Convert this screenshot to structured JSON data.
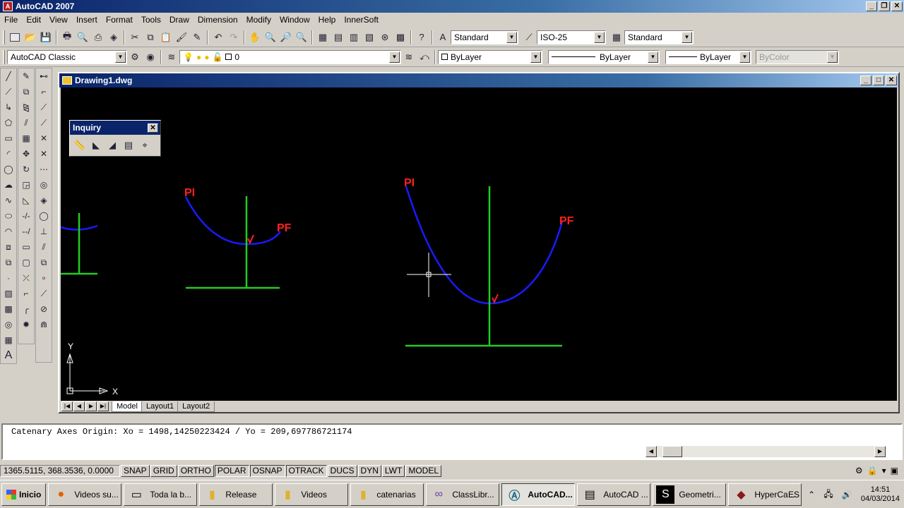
{
  "app": {
    "title": "AutoCAD 2007"
  },
  "menu": [
    "File",
    "Edit",
    "View",
    "Insert",
    "Format",
    "Tools",
    "Draw",
    "Dimension",
    "Modify",
    "Window",
    "Help",
    "InnerSoft"
  ],
  "toolbar": {
    "text_style": "Standard",
    "dim_style": "ISO-25",
    "table_style": "Standard",
    "workspace": "AutoCAD Classic",
    "layer": "0",
    "color": "ByLayer",
    "linetype": "ByLayer",
    "lineweight": "ByLayer",
    "plotstyle": "ByColor"
  },
  "document": {
    "title": "Drawing1.dwg"
  },
  "inquiry": {
    "title": "Inquiry"
  },
  "drawing": {
    "labels": {
      "pi": "PI",
      "pf": "PF"
    },
    "ucs": {
      "x": "X",
      "y": "Y"
    },
    "colors": {
      "curve": "#1a1aff",
      "axis": "#22cc22",
      "label": "#ff2020",
      "background": "#000000"
    }
  },
  "tabs": [
    "Model",
    "Layout1",
    "Layout2"
  ],
  "command": {
    "line": "Catenary Axes Origin: Xo = 1498,14250223424 / Yo = 209,697786721174"
  },
  "status": {
    "coords": "1365.5115, 368.3536, 0.0000",
    "toggles": [
      "SNAP",
      "GRID",
      "ORTHO",
      "POLAR",
      "OSNAP",
      "OTRACK",
      "DUCS",
      "DYN",
      "LWT",
      "MODEL"
    ]
  },
  "taskbar": {
    "start": "Inicio",
    "tasks": [
      {
        "label": "Videos su...",
        "icon": "firefox-icon"
      },
      {
        "label": "Toda la b...",
        "icon": "window-icon"
      },
      {
        "label": "Release",
        "icon": "folder-icon"
      },
      {
        "label": "Videos",
        "icon": "folder-icon"
      },
      {
        "label": "catenarias",
        "icon": "folder-icon"
      },
      {
        "label": "ClassLibr...",
        "icon": "vs-icon"
      },
      {
        "label": "AutoCAD...",
        "icon": "autocad-icon",
        "active": true
      },
      {
        "label": "AutoCAD ...",
        "icon": "autocad-text-icon"
      },
      {
        "label": "Geometri...",
        "icon": "geometry-icon"
      },
      {
        "label": "HyperCa...",
        "icon": "hypercam-icon"
      }
    ],
    "lang": "ES",
    "time": "14:51",
    "date": "04/03/2014"
  }
}
